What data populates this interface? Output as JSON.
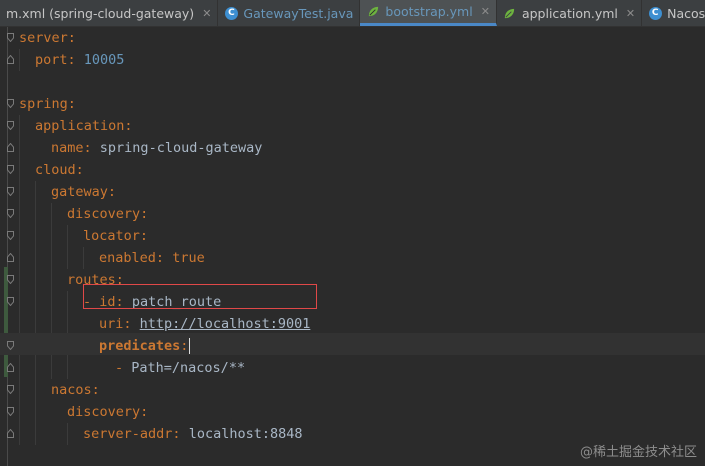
{
  "tabs": [
    {
      "label": "m.xml (spring-cloud-gateway)",
      "icon": "maven-file-icon",
      "active": false,
      "closable": true
    },
    {
      "label": "GatewayTest.java",
      "icon": "java-class-icon",
      "active": false,
      "closable": false
    },
    {
      "label": "bootstrap.yml",
      "icon": "spring-yaml-icon",
      "active": true,
      "closable": true
    },
    {
      "label": "application.yml",
      "icon": "spring-yaml-icon",
      "active": false,
      "closable": true
    },
    {
      "label": "NacosCont",
      "icon": "java-class-icon",
      "active": false,
      "closable": false
    }
  ],
  "code": {
    "server_key": "server",
    "port_key": "port",
    "port_val": "10005",
    "spring_key": "spring",
    "application_key": "application",
    "name_key": "name",
    "name_val": "spring-cloud-gateway",
    "cloud_key": "cloud",
    "gateway_key": "gateway",
    "discovery_key": "discovery",
    "locator_key": "locator",
    "enabled_key": "enabled",
    "enabled_val": "true",
    "routes_key": "routes",
    "dash": "-",
    "id_key": "id",
    "id_val": "patch_route",
    "uri_key": "uri",
    "uri_val": "http://localhost:9001",
    "predicates_key": "predicates",
    "path_item": "Path=/nacos/**",
    "nacos_key": "nacos",
    "discovery2_key": "discovery",
    "server_addr_key": "server-addr",
    "server_addr_val": "localhost:8848",
    "colon": ":"
  },
  "watermark": "@稀土掘金技术社区",
  "colors": {
    "background": "#2b2b2b",
    "key": "#cc7832",
    "number": "#6897bb",
    "text": "#a9b7c6",
    "highlight_box": "#e04848"
  }
}
